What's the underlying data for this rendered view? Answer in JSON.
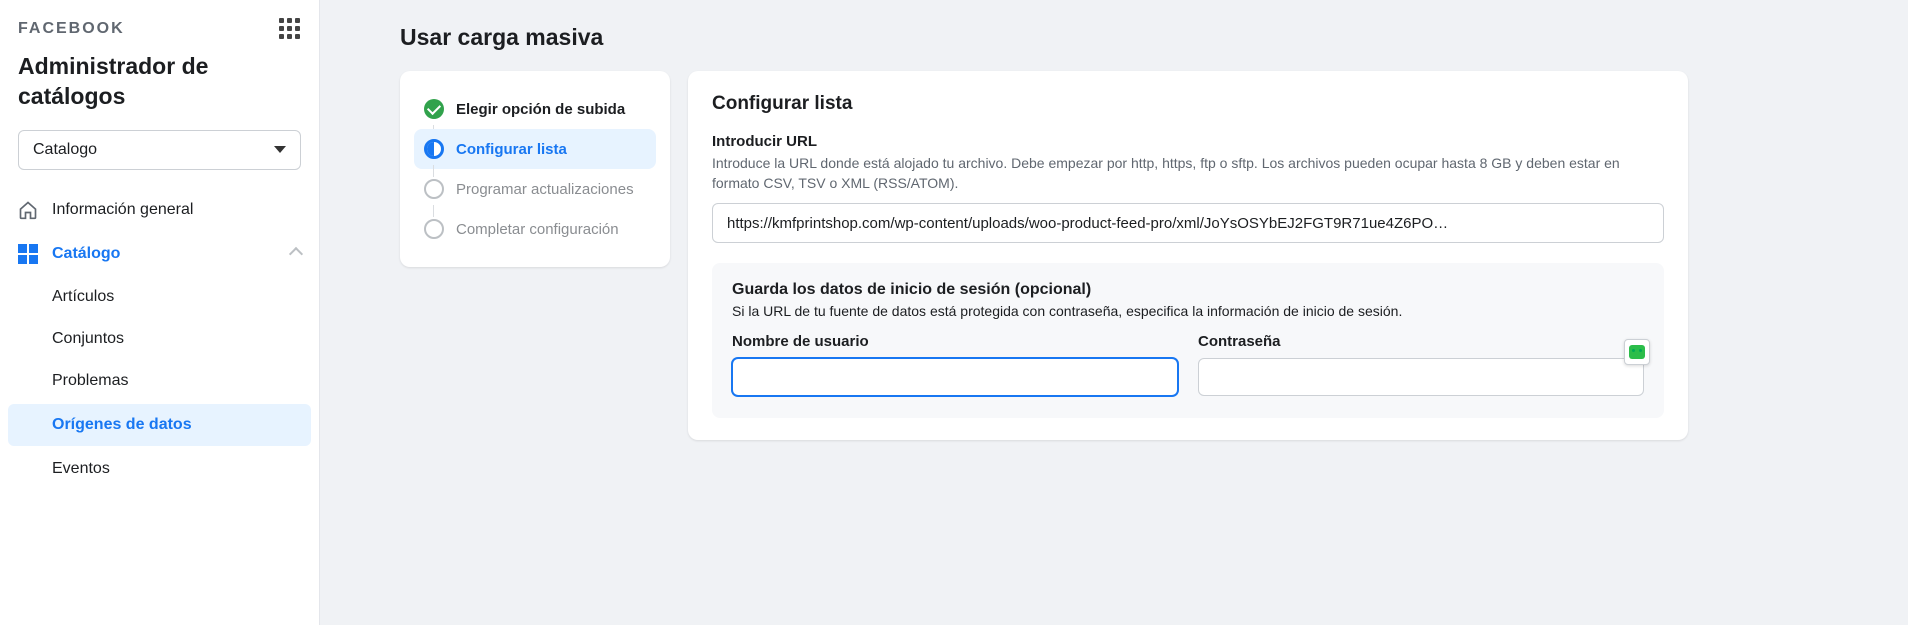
{
  "brand": "FACEBOOK",
  "app_title": "Administrador de catálogos",
  "catalog_selector": {
    "value": "Catalogo"
  },
  "nav": {
    "overview": "Información general",
    "catalog": "Catálogo",
    "articles": "Artículos",
    "sets": "Conjuntos",
    "problems": "Problemas",
    "data_sources": "Orígenes de datos",
    "events": "Eventos"
  },
  "page_heading": "Usar carga masiva",
  "steps": {
    "choose": "Elegir opción de subida",
    "configure": "Configurar lista",
    "schedule": "Programar actualizaciones",
    "complete": "Completar configuración"
  },
  "config": {
    "title": "Configurar lista",
    "url_label": "Introducir URL",
    "url_help": "Introduce la URL donde está alojado tu archivo. Debe empezar por http, https, ftp o sftp. Los archivos pueden ocupar hasta 8 GB y deben estar en formato CSV, TSV o XML (RSS/ATOM).",
    "url_value": "https://kmfprintshop.com/wp-content/uploads/woo-product-feed-pro/xml/JoYsOSYbEJ2FGT9R71ue4Z6PO…",
    "login_title": "Guarda los datos de inicio de sesión (opcional)",
    "login_help": "Si la URL de tu fuente de datos está protegida con contraseña, especifica la información de inicio de sesión.",
    "username_label": "Nombre de usuario",
    "password_label": "Contraseña"
  }
}
